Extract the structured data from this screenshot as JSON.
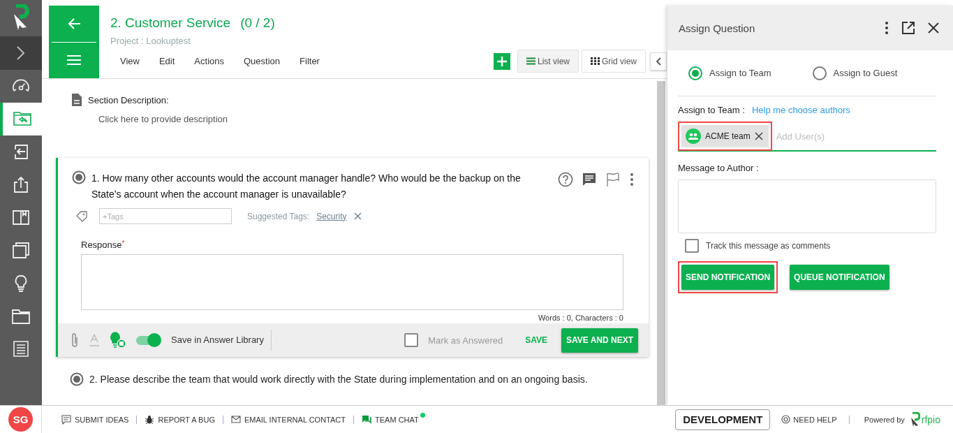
{
  "sidebar": {
    "items": [
      {
        "kind": "dashboard",
        "selected": false
      },
      {
        "kind": "respond",
        "selected": true
      },
      {
        "kind": "import",
        "selected": false
      },
      {
        "kind": "export",
        "selected": false
      },
      {
        "kind": "book",
        "selected": false
      },
      {
        "kind": "copies",
        "selected": false
      },
      {
        "kind": "bulb",
        "selected": false
      },
      {
        "kind": "folder",
        "selected": false
      },
      {
        "kind": "document",
        "selected": false
      }
    ],
    "avatar": "SG"
  },
  "header": {
    "title": "2. Customer Service",
    "progress": "(0 / 2)",
    "project": "Project : Lookuptest",
    "menu": [
      "View",
      "Edit",
      "Actions",
      "Question",
      "Filter"
    ],
    "views": [
      {
        "kind": "list",
        "label": "List view",
        "selected": true
      },
      {
        "kind": "grid",
        "label": "Grid view",
        "selected": false
      }
    ]
  },
  "section": {
    "label": "Section Description:",
    "placeholder": "Click here to provide description"
  },
  "questions": [
    {
      "text": "1. How many other accounts would the account manager handle? Who would be the backup on the State’s account when the account manager is unavailable?",
      "tags_placeholder": "+Tags",
      "suggested_label": "Suggested Tags:",
      "suggested_tags": [
        "Security"
      ],
      "response_label": "Response",
      "required_mark": "*",
      "counter": "Words : 0, Characters : 0",
      "save_in_library": true,
      "library_label": "Save in Answer Library",
      "mark_answered": false,
      "mark_label": "Mark as Answered",
      "save": "SAVE",
      "save_next": "SAVE AND NEXT"
    },
    {
      "text": "2. Please describe the team that would work directly with the State during implementation and on an ongoing basis."
    }
  ],
  "panel": {
    "title": "Assign Question",
    "options": [
      {
        "label": "Assign to Team",
        "selected": true
      },
      {
        "label": "Assign to Guest",
        "selected": false
      }
    ],
    "assign_label": "Assign to Team :",
    "help_link": "Help me choose authors",
    "chips": [
      {
        "label": "ACME team",
        "highlighted": true
      }
    ],
    "users_placeholder": "Add User(s)",
    "message_label": "Message to Author :",
    "track": {
      "label": "Track this message as comments",
      "checked": false
    },
    "buttons": [
      {
        "label": "SEND NOTIFICATION",
        "highlighted": true
      },
      {
        "label": "QUEUE NOTIFICATION",
        "highlighted": false
      }
    ]
  },
  "footer": {
    "links": [
      {
        "kind": "ideas",
        "label": "SUBMIT IDEAS"
      },
      {
        "kind": "bug",
        "label": "REPORT A BUG"
      },
      {
        "kind": "mail",
        "label": "EMAIL INTERNAL CONTACT"
      },
      {
        "kind": "chat",
        "label": "TEAM CHAT",
        "online": true
      }
    ],
    "environment": "DEVELOPMENT",
    "help": "NEED HELP",
    "powered": "Powered by",
    "brand": "rfpio"
  }
}
